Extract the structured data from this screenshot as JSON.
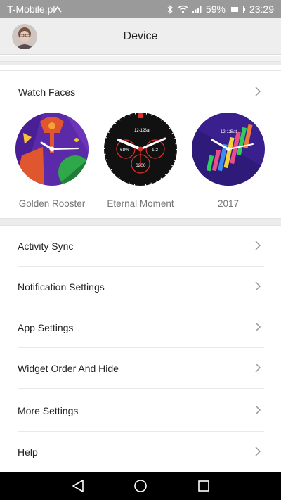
{
  "status_bar": {
    "carrier": "T-Mobile.pl",
    "battery": "59%",
    "time": "23:29"
  },
  "header": {
    "title": "Device"
  },
  "watch_faces": {
    "heading": "Watch Faces",
    "items": [
      {
        "name": "Golden Rooster"
      },
      {
        "name": "Eternal Moment",
        "date": "12-12",
        "day": "Sat",
        "left": "68%",
        "right": "1.2",
        "bottom": "6200"
      },
      {
        "name": "2017",
        "date": "12-12",
        "day": "Sat"
      }
    ]
  },
  "menu": {
    "items": [
      {
        "label": "Activity Sync"
      },
      {
        "label": "Notification Settings"
      },
      {
        "label": "App Settings"
      },
      {
        "label": "Widget Order And Hide"
      },
      {
        "label": "More Settings"
      },
      {
        "label": "Help"
      }
    ]
  },
  "nav": {
    "back_icon": "back-triangle-icon",
    "home_icon": "home-circle-icon",
    "recents_icon": "recents-square-icon"
  }
}
